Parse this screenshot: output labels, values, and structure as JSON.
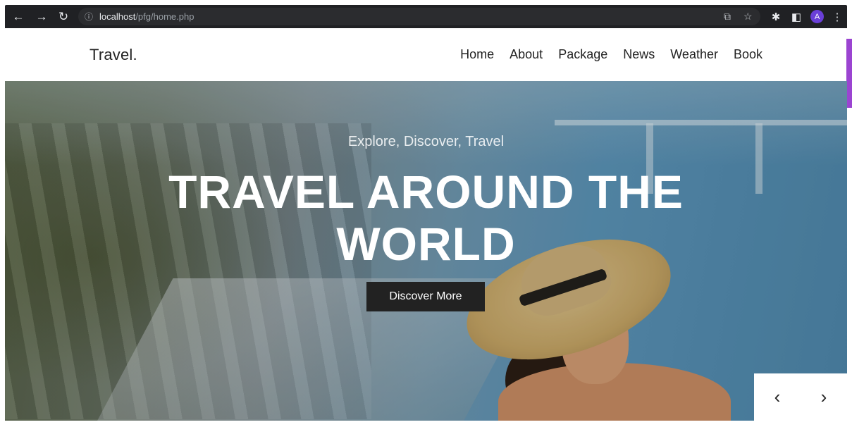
{
  "browser": {
    "url_host": "localhost",
    "url_path": "/pfg/home.php",
    "profile_initial": "A",
    "icons": [
      "back-icon",
      "forward-icon",
      "reload-icon",
      "info-icon",
      "share-icon",
      "star-icon",
      "extensions-icon",
      "sidepanel-icon",
      "menu-icon"
    ]
  },
  "site": {
    "logo": "Travel.",
    "menu": [
      "Home",
      "About",
      "Package",
      "News",
      "Weather",
      "Book"
    ]
  },
  "hero": {
    "tagline": "Explore, Discover, Travel",
    "headline_line1": "TRAVEL AROUND THE",
    "headline_line2": "WORLD",
    "cta": "Discover More"
  },
  "slider": {
    "prev_icon": "chevron-left-icon",
    "next_icon": "chevron-right-icon"
  },
  "colors": {
    "chrome_bg": "#202124",
    "cta_bg": "#222222",
    "scroll_accent": "#9b44d1"
  }
}
